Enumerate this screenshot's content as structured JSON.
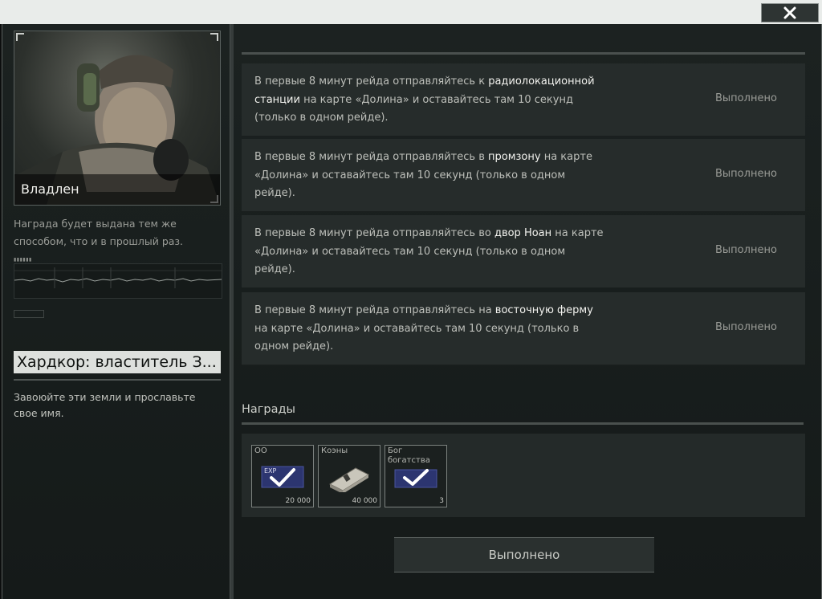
{
  "window": {
    "close_icon": "close-icon"
  },
  "trader": {
    "name": "Владлен",
    "reward_note": "Награда будет выдана тем же способом, что и в прошлый раз."
  },
  "quest": {
    "title": "Хардкор: властитель З...",
    "description": "Завоюйте эти земли и прославьте свое имя."
  },
  "objectives": [
    {
      "pre": "В первые 8 минут рейда отправляйтесь к ",
      "highlight": "радиолокационной станции",
      "post": " на карте «Долина» и оставайтесь там 10 секунд (только в одном рейде).",
      "status": "Выполнено"
    },
    {
      "pre": "В первые 8 минут рейда отправляйтесь в ",
      "highlight": "промзону",
      "post": " на карте «Долина» и оставайтесь там 10 секунд (только в одном рейде).",
      "status": "Выполнено"
    },
    {
      "pre": "В первые 8 минут рейда отправляйтесь во ",
      "highlight": "двор Ноан",
      "post": " на карте «Долина» и оставайтесь там 10 секунд (только в одном рейде).",
      "status": "Выполнено"
    },
    {
      "pre": "В первые 8 минут рейда отправляйтесь на ",
      "highlight": "восточную ферму",
      "post": " на карте «Долина» и оставайтесь там 10 секунд (только в одном рейде).",
      "status": "Выполнено"
    }
  ],
  "rewards": {
    "label": "Награды",
    "items": [
      {
        "name": "ОО",
        "value": "20 000",
        "icon": "exp-card-icon",
        "badge": "EXP",
        "checked": true
      },
      {
        "name": "Коэны",
        "value": "40 000",
        "icon": "cash-stack-icon",
        "checked": false
      },
      {
        "name": "Бог богатства",
        "value": "3",
        "icon": "title-card-icon",
        "checked": true
      }
    ]
  },
  "complete_button": {
    "label": "Выполнено"
  },
  "colors": {
    "accent_title_bg": "#dde0dd",
    "panel_bg": "#262c2b"
  }
}
